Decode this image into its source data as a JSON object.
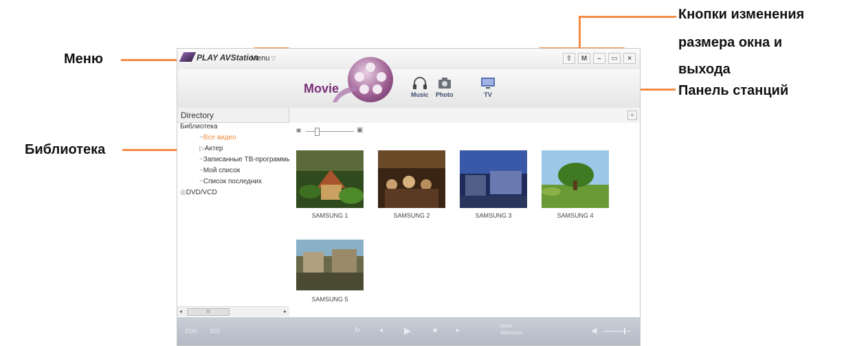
{
  "callouts": {
    "menu": "Меню",
    "library": "Библиотека",
    "window_buttons": [
      "Кнопки изменения",
      "размера окна и",
      "выхода"
    ],
    "station_panel": "Панель станций"
  },
  "app": {
    "title": "PLAY AVStation",
    "menu_label": "Menu",
    "window_buttons": [
      "⇧",
      "M",
      "–",
      "▭",
      "×"
    ],
    "stations": {
      "movie": "Movie",
      "music": "Music",
      "photo": "Photo",
      "tv": "TV"
    },
    "directory_header": "Directory",
    "tree": {
      "library": "Библиотека",
      "all_videos": "Все видео",
      "actor": "Актер",
      "recorded_tv": "Записанные ТВ-программы",
      "my_list": "Мой список",
      "recent_list": "Список последних",
      "dvd_vcd": "DVD/VCD"
    },
    "scrollbar_thumb": "III",
    "videos": [
      "SAMSUNG 1",
      "SAMSUNG 2",
      "SAMSUNG 3",
      "SAMSUNG 4",
      "SAMSUNG 5"
    ],
    "bottom": {
      "eds": "EDS",
      "edi": "EDI",
      "make_label": "Make",
      "mode_label": "Slideshow"
    }
  }
}
